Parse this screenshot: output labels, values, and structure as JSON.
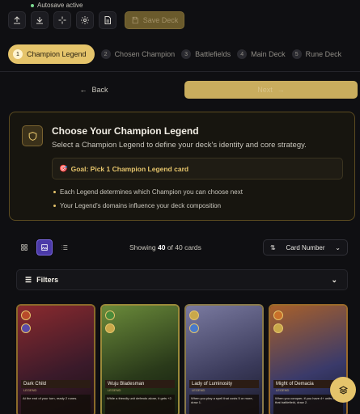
{
  "autosave": {
    "label": "Autosave active"
  },
  "toolbar": {
    "save_label": "Save Deck"
  },
  "steps": [
    {
      "num": "1",
      "label": "Champion Legend"
    },
    {
      "num": "2",
      "label": "Chosen Champion"
    },
    {
      "num": "3",
      "label": "Battlefields"
    },
    {
      "num": "4",
      "label": "Main Deck"
    },
    {
      "num": "5",
      "label": "Rune Deck"
    }
  ],
  "nav": {
    "back_label": "Back",
    "next_label": "Next"
  },
  "panel": {
    "title": "Choose Your Champion Legend",
    "subtitle": "Select a Champion Legend to define your deck's identity and core strategy.",
    "goal": "Goal: Pick 1 Champion Legend card",
    "bullets": [
      "Each Legend determines which Champion you can choose next",
      "Your Legend's domains influence your deck composition"
    ]
  },
  "results": {
    "prefix": "Showing",
    "shown": "40",
    "mid": "of 40 cards"
  },
  "sort": {
    "value": "Card Number"
  },
  "filters": {
    "label": "Filters"
  },
  "cards": [
    {
      "name": "Dark Child",
      "type": "LEGEND",
      "text": "At the end of your turn, ready 2 runes.",
      "color": "#8a2a2e",
      "color2": "#3a1a2a"
    },
    {
      "name": "Wuju Bladesman",
      "type": "LEGEND",
      "text": "While a friendly unit defends alone, it gets +2.",
      "color": "#4a6a2a",
      "color2": "#1f2a18"
    },
    {
      "name": "Lady of Luminosity",
      "type": "LEGEND",
      "text": "When you play a spell that costs 5 or more, draw 1.",
      "color": "#6a6a8a",
      "color2": "#2a2a40"
    },
    {
      "name": "Might of Demacia",
      "type": "LEGEND",
      "text": "When you conquer, if you have 4+ units at that battlefield, draw 2.",
      "color": "#8a5a2a",
      "color2": "#1f2a4a"
    }
  ]
}
